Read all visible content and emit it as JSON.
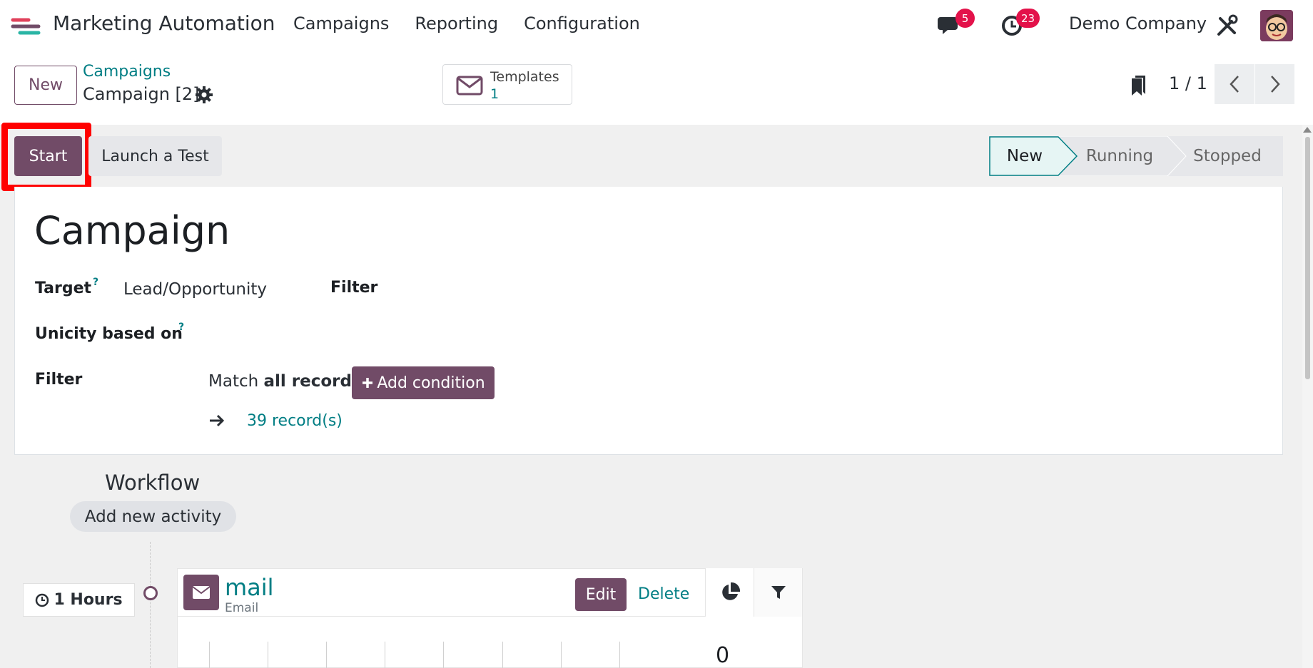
{
  "app": {
    "title": "Marketing Automation",
    "menu": [
      "Campaigns",
      "Reporting",
      "Configuration"
    ],
    "company": "Demo Company",
    "messages_count": "5",
    "activities_count": "23"
  },
  "control_panel": {
    "new_label": "New",
    "breadcrumb_parent": "Campaigns",
    "record_name": "Campaign [2]",
    "smart_button": {
      "label": "Templates",
      "count": "1"
    },
    "pager": "1 / 1"
  },
  "statusbar": {
    "start_label": "Start",
    "test_label": "Launch a Test",
    "stages": [
      "New",
      "Running",
      "Stopped"
    ],
    "current_stage": "New"
  },
  "form": {
    "title": "Campaign",
    "target_label": "Target",
    "target_value": "Lead/Opportunity",
    "filter_col_label": "Filter",
    "unicity_label": "Unicity based on",
    "help_mark": "?",
    "filter_label": "Filter",
    "match_prefix": "Match ",
    "match_bold": "all records",
    "add_condition_label": "Add condition",
    "records_link": "39 record(s)"
  },
  "workflow": {
    "title": "Workflow",
    "add_activity_label": "Add new activity",
    "interval": "1 Hours",
    "activity": {
      "name": "mail",
      "type": "Email",
      "edit_label": "Edit",
      "delete_label": "Delete",
      "stat_value": "0"
    }
  },
  "colors": {
    "primary": "#714b67",
    "link": "#017e84",
    "badge": "#e3124a",
    "highlight": "#ff0000"
  }
}
